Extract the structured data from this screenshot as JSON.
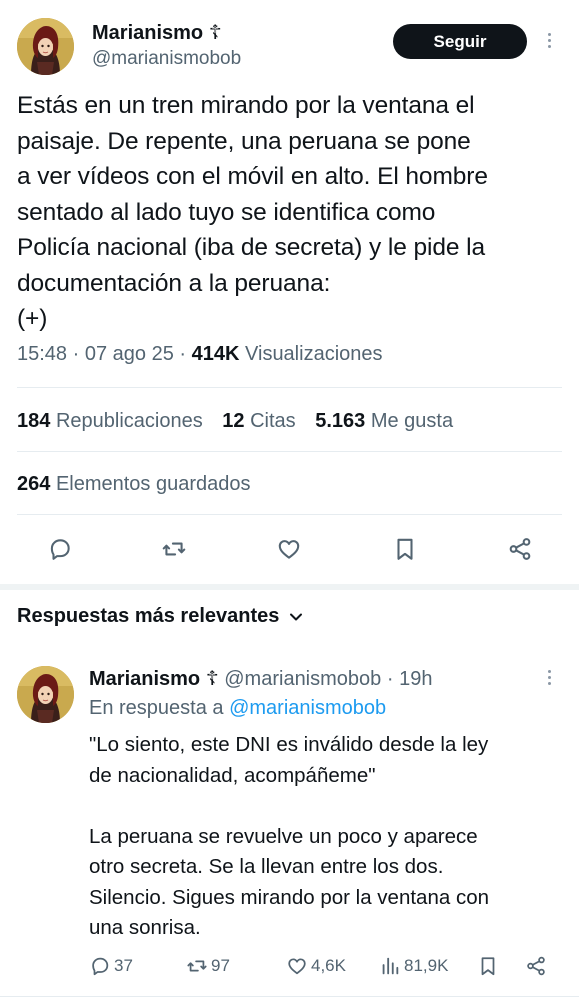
{
  "main_tweet": {
    "author_name": "Marianismo ☦",
    "author_handle": "@marianismobob",
    "follow_label": "Seguir",
    "text": "Estás en un tren mirando por la ventana el\npaisaje. De repente, una peruana se pone\na ver vídeos con el móvil en alto. El hombre\nsentado al lado tuyo se identifica como\nPolicía nacional (iba de secreta) y le pide la\ndocumentación a la peruana:\n(+)",
    "time": "15:48",
    "date": "07 ago 25",
    "views_count": "414K",
    "views_label": "Visualizaciones",
    "stats": {
      "reposts_count": "184",
      "reposts_label": "Republicaciones",
      "quotes_count": "12",
      "quotes_label": "Citas",
      "likes_count": "5.163",
      "likes_label": "Me gusta",
      "bookmarks_count": "264",
      "bookmarks_label": "Elementos guardados"
    },
    "actions": [
      "reply-icon",
      "repost-icon",
      "like-icon",
      "bookmark-icon",
      "share-icon"
    ]
  },
  "replies": {
    "sort_label": "Respuestas más relevantes",
    "items": [
      {
        "author_name": "Marianismo ☦",
        "author_handle": "@marianismobob",
        "age": "19h",
        "in_reply_prefix": "En respuesta a",
        "in_reply_handle": "@marianismobob",
        "text": "\"Lo siento, este DNI es inválido desde la ley\nde nacionalidad, acompáñeme\"\n\nLa peruana se revuelve un poco y aparece\notro secreta. Se la llevan entre los dos.\nSilencio. Sigues mirando por la ventana con\nuna sonrisa.",
        "reply_count": "37",
        "repost_count": "97",
        "like_count": "4,6K",
        "view_count": "81,9K"
      }
    ]
  },
  "colors": {
    "text_primary": "#0f1419",
    "text_secondary": "#536471",
    "link": "#1d9bf0",
    "button_bg": "#0f1419"
  }
}
